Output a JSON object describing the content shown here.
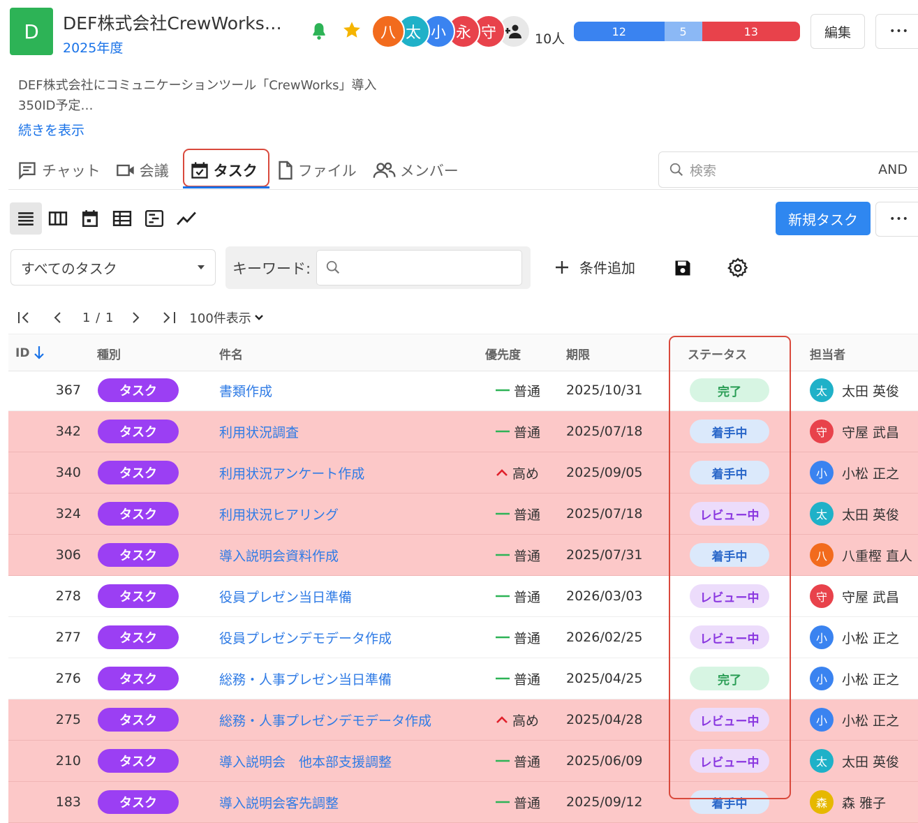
{
  "header": {
    "logo_letter": "D",
    "title": "DEF株式会社CrewWorks…",
    "year": "2025年度",
    "members": [
      {
        "initial": "八",
        "color": "#f26b1d"
      },
      {
        "initial": "太",
        "color": "#1fb1c8"
      },
      {
        "initial": "小",
        "color": "#3a83f0"
      },
      {
        "initial": "永",
        "color": "#e8424b"
      },
      {
        "initial": "守",
        "color": "#e8424b"
      }
    ],
    "member_count": "10人",
    "progress": [
      {
        "value": "12",
        "count": 12,
        "color": "#3a83f0"
      },
      {
        "value": "5",
        "count": 5,
        "color": "#8bb8f5"
      },
      {
        "value": "13",
        "count": 13,
        "color": "#e8424b"
      }
    ],
    "edit_label": "編集",
    "more_label": "•••"
  },
  "description": {
    "line1": "DEF株式会社にコミュニケーションツール「CrewWorks」導入",
    "line2": "350ID予定…",
    "show_more": "続きを表示"
  },
  "tabs": {
    "chat": "チャット",
    "meeting": "会議",
    "task": "タスク",
    "file": "ファイル",
    "member": "メンバー"
  },
  "search": {
    "placeholder": "検索",
    "mode": "AND"
  },
  "toolbar": {
    "new_task": "新規タスク",
    "more_label": "•••"
  },
  "filter": {
    "selected": "すべてのタスク",
    "keyword_label": "キーワード:",
    "add_condition": "条件追加"
  },
  "pager": {
    "page": "1 / 1",
    "per_page": "100件表示"
  },
  "columns": {
    "id": "ID",
    "type": "種別",
    "name": "件名",
    "priority": "優先度",
    "due": "期限",
    "status": "ステータス",
    "assignee": "担当者"
  },
  "rows": [
    {
      "id": "367",
      "type": "タスク",
      "name": "書類作成",
      "priority": "普通",
      "priority_level": "normal",
      "due": "2025/10/31",
      "status": "完了",
      "status_kind": "done",
      "assignee_initial": "太",
      "assignee_color": "#1fb1c8",
      "assignee": "太田 英俊",
      "alert": false
    },
    {
      "id": "342",
      "type": "タスク",
      "name": "利用状況調査",
      "priority": "普通",
      "priority_level": "normal",
      "due": "2025/07/18",
      "status": "着手中",
      "status_kind": "prog",
      "assignee_initial": "守",
      "assignee_color": "#e8424b",
      "assignee": "守屋 武昌",
      "alert": true
    },
    {
      "id": "340",
      "type": "タスク",
      "name": "利用状況アンケート作成",
      "priority": "高め",
      "priority_level": "high",
      "due": "2025/09/05",
      "status": "着手中",
      "status_kind": "prog",
      "assignee_initial": "小",
      "assignee_color": "#3a83f0",
      "assignee": "小松 正之",
      "alert": true
    },
    {
      "id": "324",
      "type": "タスク",
      "name": "利用状況ヒアリング",
      "priority": "普通",
      "priority_level": "normal",
      "due": "2025/07/18",
      "status": "レビュー中",
      "status_kind": "rev",
      "assignee_initial": "太",
      "assignee_color": "#1fb1c8",
      "assignee": "太田 英俊",
      "alert": true
    },
    {
      "id": "306",
      "type": "タスク",
      "name": "導入説明会資料作成",
      "priority": "普通",
      "priority_level": "normal",
      "due": "2025/07/31",
      "status": "着手中",
      "status_kind": "prog",
      "assignee_initial": "八",
      "assignee_color": "#f26b1d",
      "assignee": "八重樫 直人",
      "alert": true
    },
    {
      "id": "278",
      "type": "タスク",
      "name": "役員プレゼン当日準備",
      "priority": "普通",
      "priority_level": "normal",
      "due": "2026/03/03",
      "status": "レビュー中",
      "status_kind": "rev",
      "assignee_initial": "守",
      "assignee_color": "#e8424b",
      "assignee": "守屋 武昌",
      "alert": false
    },
    {
      "id": "277",
      "type": "タスク",
      "name": "役員プレゼンデモデータ作成",
      "priority": "普通",
      "priority_level": "normal",
      "due": "2026/02/25",
      "status": "レビュー中",
      "status_kind": "rev",
      "assignee_initial": "小",
      "assignee_color": "#3a83f0",
      "assignee": "小松 正之",
      "alert": false
    },
    {
      "id": "276",
      "type": "タスク",
      "name": "総務・人事プレゼン当日準備",
      "priority": "普通",
      "priority_level": "normal",
      "due": "2025/04/25",
      "status": "完了",
      "status_kind": "done",
      "assignee_initial": "小",
      "assignee_color": "#3a83f0",
      "assignee": "小松 正之",
      "alert": false
    },
    {
      "id": "275",
      "type": "タスク",
      "name": "総務・人事プレゼンデモデータ作成",
      "priority": "高め",
      "priority_level": "high",
      "due": "2025/04/28",
      "status": "レビュー中",
      "status_kind": "rev",
      "assignee_initial": "小",
      "assignee_color": "#3a83f0",
      "assignee": "小松 正之",
      "alert": true
    },
    {
      "id": "210",
      "type": "タスク",
      "name": "導入説明会　他本部支援調整",
      "priority": "普通",
      "priority_level": "normal",
      "due": "2025/06/09",
      "status": "レビュー中",
      "status_kind": "rev",
      "assignee_initial": "太",
      "assignee_color": "#1fb1c8",
      "assignee": "太田 英俊",
      "alert": true
    },
    {
      "id": "183",
      "type": "タスク",
      "name": "導入説明会客先調整",
      "priority": "普通",
      "priority_level": "normal",
      "due": "2025/09/12",
      "status": "着手中",
      "status_kind": "prog",
      "assignee_initial": "森",
      "assignee_color": "#e6b800",
      "assignee": "森 雅子",
      "alert": true
    }
  ]
}
